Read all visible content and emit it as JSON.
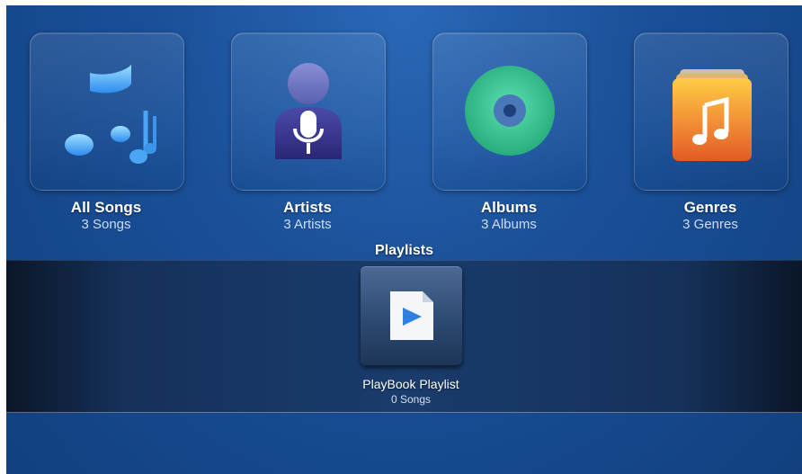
{
  "categories": [
    {
      "title": "All Songs",
      "subtitle": "3 Songs",
      "icon": "music-notes-icon"
    },
    {
      "title": "Artists",
      "subtitle": "3 Artists",
      "icon": "artist-microphone-icon"
    },
    {
      "title": "Albums",
      "subtitle": "3 Albums",
      "icon": "album-disc-icon"
    },
    {
      "title": "Genres",
      "subtitle": "3 Genres",
      "icon": "genre-folder-icon"
    }
  ],
  "playlists": {
    "section_title": "Playlists",
    "items": [
      {
        "title": "PlayBook Playlist",
        "subtitle": "0 Songs",
        "icon": "playlist-file-icon"
      }
    ]
  },
  "colors": {
    "background": "#1a4f98",
    "shelf": "#15315a",
    "text": "#ffffff",
    "disc": "#3cc79a",
    "genre_folder": "#f28a2e"
  }
}
